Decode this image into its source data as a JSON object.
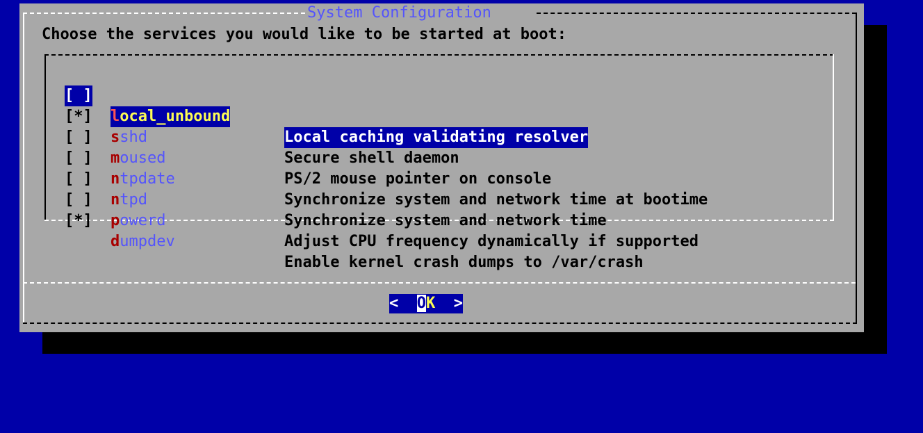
{
  "dialog": {
    "title": "System Configuration",
    "prompt": "Choose the services you would like to be started at boot:"
  },
  "services": [
    {
      "check": "[ ]",
      "hotkey": "l",
      "rest": "ocal_unbound",
      "description": "Local caching validating resolver",
      "selected": true
    },
    {
      "check": "[*]",
      "hotkey": "s",
      "rest": "shd",
      "description": "Secure shell daemon",
      "selected": false
    },
    {
      "check": "[ ]",
      "hotkey": "m",
      "rest": "oused",
      "description": "PS/2 mouse pointer on console",
      "selected": false
    },
    {
      "check": "[ ]",
      "hotkey": "n",
      "rest": "tpdate",
      "description": "Synchronize system and network time at bootime",
      "selected": false
    },
    {
      "check": "[ ]",
      "hotkey": "n",
      "rest": "tpd",
      "description": "Synchronize system and network time",
      "selected": false
    },
    {
      "check": "[ ]",
      "hotkey": "p",
      "rest": "owerd",
      "description": "Adjust CPU frequency dynamically if supported",
      "selected": false
    },
    {
      "check": "[*]",
      "hotkey": "d",
      "rest": "umpdev",
      "description": "Enable kernel crash dumps to /var/crash",
      "selected": false
    }
  ],
  "ok_button": {
    "left": "<  ",
    "cursor": "O",
    "hot": "K",
    "right": "  >"
  },
  "colors": {
    "background": "#0000a8",
    "dialog": "#a8a8a8",
    "title": "#5454fc",
    "hotkey": "#a80000"
  }
}
